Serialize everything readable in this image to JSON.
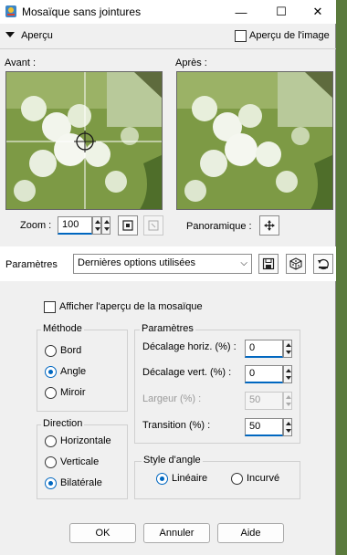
{
  "window": {
    "title": "Mosaïque sans jointures",
    "minimize": "—",
    "maximize": "☐",
    "close": "✕"
  },
  "preview_bar": {
    "toggle_label": "Aperçu",
    "image_preview_label": "Aperçu de l'image",
    "image_preview_checked": false
  },
  "previews": {
    "before_label": "Avant :",
    "after_label": "Après :"
  },
  "zoom": {
    "label": "Zoom :",
    "value": "100"
  },
  "pan": {
    "label": "Panoramique :"
  },
  "presets": {
    "label": "Paramètres",
    "selected": "Dernières options utilisées"
  },
  "mosaic_preview": {
    "label": "Afficher l'aperçu de la mosaïque",
    "checked": false
  },
  "method": {
    "title": "Méthode",
    "options": [
      "Bord",
      "Angle",
      "Miroir"
    ],
    "selected": "Angle"
  },
  "direction": {
    "title": "Direction",
    "options": [
      "Horizontale",
      "Verticale",
      "Bilatérale"
    ],
    "selected": "Bilatérale"
  },
  "params": {
    "title": "Paramètres",
    "h_offset_label": "Décalage horiz. (%) :",
    "h_offset_value": "0",
    "v_offset_label": "Décalage vert. (%) :",
    "v_offset_value": "0",
    "width_label": "Largeur (%) :",
    "width_value": "50",
    "transition_label": "Transition (%) :",
    "transition_value": "50"
  },
  "corner_style": {
    "title": "Style d'angle",
    "options": [
      "Linéaire",
      "Incurvé"
    ],
    "selected": "Linéaire"
  },
  "buttons": {
    "ok": "OK",
    "cancel": "Annuler",
    "help": "Aide"
  }
}
